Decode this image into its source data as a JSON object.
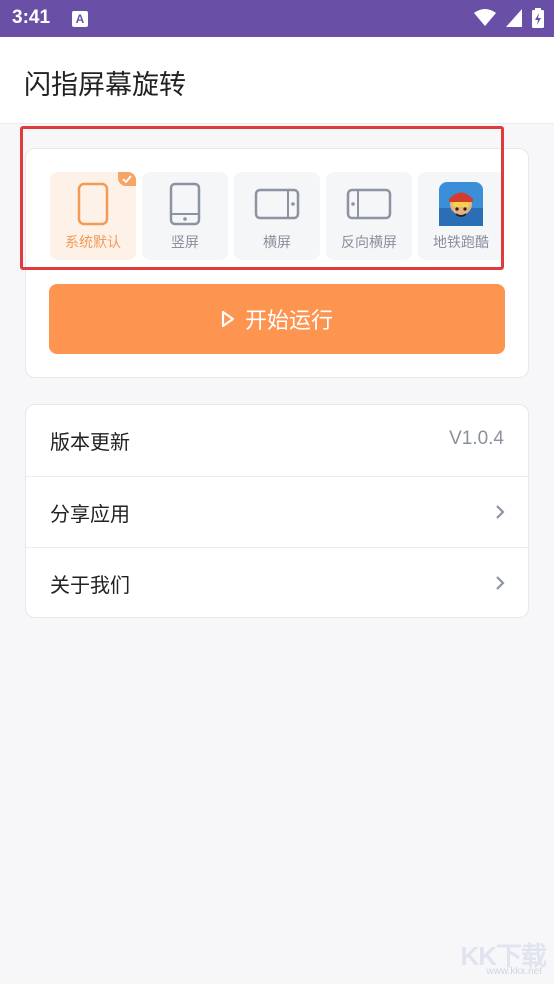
{
  "status_bar": {
    "time": "3:41",
    "notification_badge": "A"
  },
  "app": {
    "title": "闪指屏幕旋转"
  },
  "modes": [
    {
      "label": "系统默认",
      "icon": "phone-outline-icon",
      "selected": true
    },
    {
      "label": "竖屏",
      "icon": "portrait-phone-icon",
      "selected": false
    },
    {
      "label": "横屏",
      "icon": "landscape-phone-icon",
      "selected": false
    },
    {
      "label": "反向横屏",
      "icon": "reverse-landscape-phone-icon",
      "selected": false
    },
    {
      "label": "地铁跑酷",
      "icon": "subway-surfers-app-icon",
      "selected": false
    }
  ],
  "start_button": {
    "label": "开始运行"
  },
  "menu": {
    "version": {
      "label": "版本更新",
      "value": "V1.0.4"
    },
    "share": {
      "label": "分享应用"
    },
    "about": {
      "label": "关于我们"
    }
  },
  "watermark": {
    "main": "KK下载",
    "sub": "www.kkx.net"
  },
  "colors": {
    "accent": "#fd944f",
    "status_bar": "#6a4fa6",
    "highlight": "#e03a3a"
  }
}
